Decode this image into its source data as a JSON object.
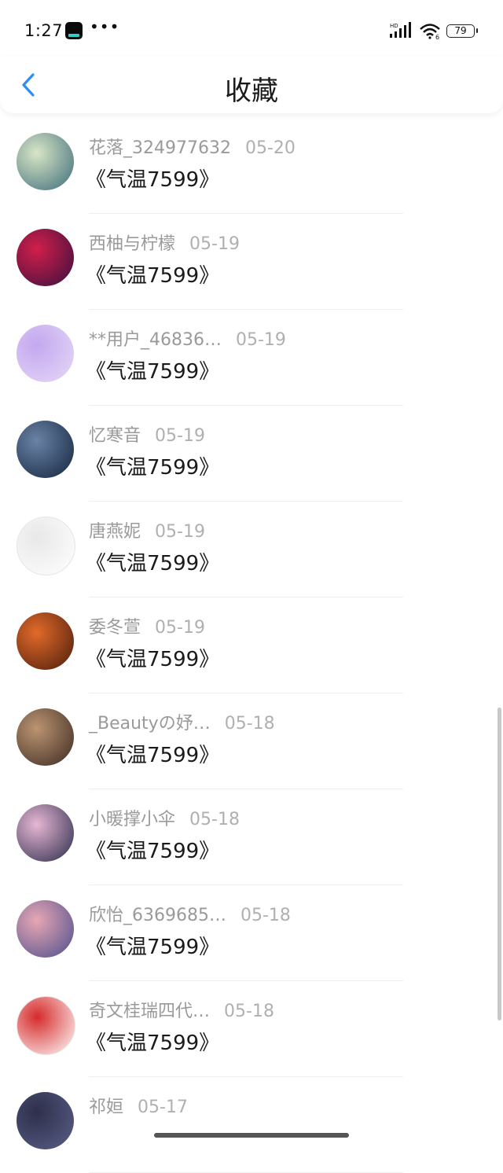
{
  "status": {
    "time": "1:27",
    "more": "•••",
    "signal_label": "HD",
    "wifi_label": "6",
    "battery": "79"
  },
  "header": {
    "title": "收藏",
    "back_icon": "chevron-left-icon",
    "accent": "#2b8ff6"
  },
  "items": [
    {
      "name": "花落_324977632",
      "date": "05-20",
      "title": "《气温7599》",
      "avatar_colors": [
        "#3b6b7a",
        "#d9e6c6"
      ]
    },
    {
      "name": "西柚与柠檬",
      "date": "05-19",
      "title": "《气温7599》",
      "avatar_colors": [
        "#3a0f3f",
        "#d11f4a"
      ]
    },
    {
      "name": "**用户_46836…",
      "date": "05-19",
      "title": "《气温7599》",
      "avatar_colors": [
        "#e6d9f7",
        "#c3a8ef"
      ]
    },
    {
      "name": "忆寒音",
      "date": "05-19",
      "title": "《气温7599》",
      "avatar_colors": [
        "#13243d",
        "#6a83a6"
      ]
    },
    {
      "name": "唐燕妮",
      "date": "05-19",
      "title": "《气温7599》",
      "avatar_colors": [
        "#ffffff",
        "#e8e8e8"
      ]
    },
    {
      "name": "委冬萱",
      "date": "05-19",
      "title": "《气温7599》",
      "avatar_colors": [
        "#4a1c0b",
        "#e26a2a"
      ]
    },
    {
      "name": "_Beautyの妤…",
      "date": "05-18",
      "title": "《气温7599》",
      "avatar_colors": [
        "#3c2a20",
        "#bb9472"
      ]
    },
    {
      "name": "小暖撑小伞",
      "date": "05-18",
      "title": "《气温7599》",
      "avatar_colors": [
        "#2a2a4a",
        "#e6b7d3"
      ]
    },
    {
      "name": "欣怡_6369685…",
      "date": "05-18",
      "title": "《气温7599》",
      "avatar_colors": [
        "#4b4d8c",
        "#e7a7b4"
      ]
    },
    {
      "name": "奇文桂瑞四代…",
      "date": "05-18",
      "title": "《气温7599》",
      "avatar_colors": [
        "#ffffff",
        "#d62b2b"
      ]
    },
    {
      "name": "祁姮",
      "date": "05-17",
      "title": "",
      "avatar_colors": [
        "#5a5f88",
        "#2e2f4a"
      ]
    }
  ]
}
